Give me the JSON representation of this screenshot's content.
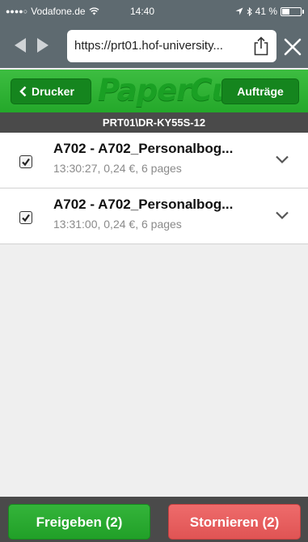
{
  "status_bar": {
    "signal_dots": "●●●●○",
    "carrier": "Vodafone.de",
    "time": "14:40",
    "battery_text": "41 %",
    "battery_level": 0.41
  },
  "browser": {
    "url": "https://prt01.hof-university...",
    "back_icon": "back-arrow-icon",
    "forward_icon": "forward-arrow-icon",
    "share_icon": "share-icon",
    "close_icon": "close-icon"
  },
  "header": {
    "brand": "PaperCut",
    "back_label": "Drucker",
    "jobs_label": "Aufträge",
    "printer_name": "PRT01\\DR-KY55S-12"
  },
  "jobs": [
    {
      "title": "A702 - A702_Personalbog...",
      "meta": "13:30:27, 0,24 €, 6 pages",
      "checked": true
    },
    {
      "title": "A702 - A702_Personalbog...",
      "meta": "13:31:00, 0,24 €, 6 pages",
      "checked": true
    }
  ],
  "footer": {
    "release_label": "Freigeben (2)",
    "cancel_label": "Stornieren (2)"
  },
  "colors": {
    "brand_green": "#2bb032",
    "cancel_red": "#e45a5a",
    "dark_bar": "#4a4a4a"
  }
}
